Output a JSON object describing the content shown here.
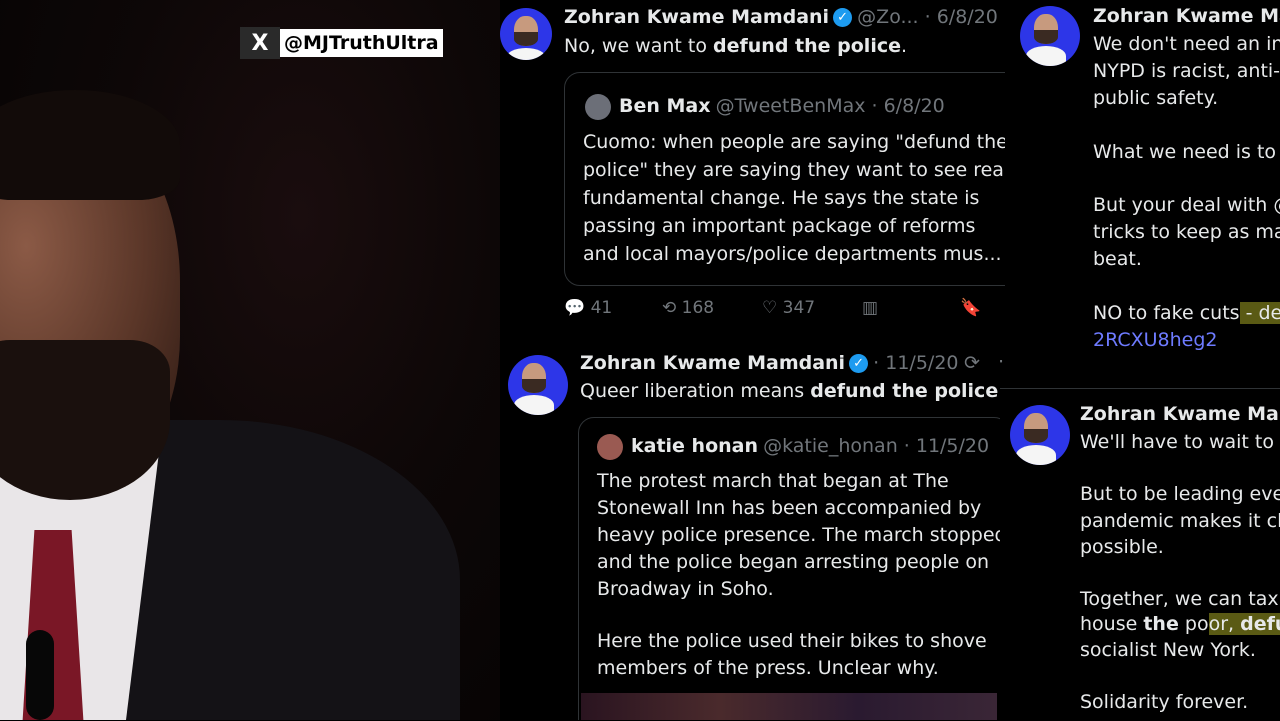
{
  "watermark": {
    "logo": "X",
    "handle": "@MJTruthUltra"
  },
  "tweet1": {
    "name": "Zohran Kwame Mamdani",
    "meta": "@Zo... · 6/8/20",
    "text_plain": "No, we want to ",
    "text_bold": "defund the police",
    "text_end": ".",
    "quote": {
      "name": "Ben Max",
      "meta": "@TweetBenMax · 6/8/20",
      "lines": [
        "Cuomo: when people are saying \"defund the",
        "police\" they are saying they want to see real",
        "fundamental change. He says the state is",
        "passing an important package of reforms",
        "and local mayors/police departments mus..."
      ]
    },
    "actions": {
      "replies": "41",
      "retweets": "168",
      "likes": "347"
    }
  },
  "tweet2": {
    "name": "Zohran Kwame Mamdani",
    "meta": "· 11/5/20",
    "text_plain": "Queer liberation means ",
    "text_bold": "defund the police",
    "text_end": ".",
    "quote": {
      "name": "katie honan",
      "meta": "@katie_honan · 11/5/20",
      "lines": [
        "The protest march that began at The",
        "Stonewall Inn has been accompanied by",
        "heavy police presence. The march stopped",
        "and the police began arresting people on",
        "Broadway in Soho.",
        "",
        "Here the police used their bikes to shove",
        "members of the press. Unclear why."
      ]
    }
  },
  "tweet3": {
    "name": "Zohran Kwame Mar",
    "lines": [
      "We don't need an inv",
      "NYPD is racist, anti-",
      "public safety.",
      "",
      "What we need is to #",
      "",
      "But your deal with @",
      "tricks to keep as ma",
      "beat.",
      ""
    ],
    "cut_plain": "NO to fake cuts",
    "cut_hl": " - de",
    "link": "2RCXU8heg2"
  },
  "tweet4": {
    "name": "Zohran Kwame Mamc",
    "lines": [
      "We'll have to wait to se",
      "",
      "But to be leading even",
      "pandemic makes it cle",
      "possible.",
      "",
      "Together, we can tax t"
    ],
    "house_a": "house ",
    "house_b": "the",
    "house_c": " po",
    "house_d": "or, ",
    "house_e": "defun",
    "line_sns": "socialist New York.",
    "line_sol": "Solidarity forever."
  },
  "icons": [
    "x-logo-icon",
    "verified-icon",
    "reply-icon",
    "retweet-icon",
    "like-icon",
    "views-icon",
    "bookmark-icon",
    "retweet-small-icon",
    "more-icon"
  ]
}
